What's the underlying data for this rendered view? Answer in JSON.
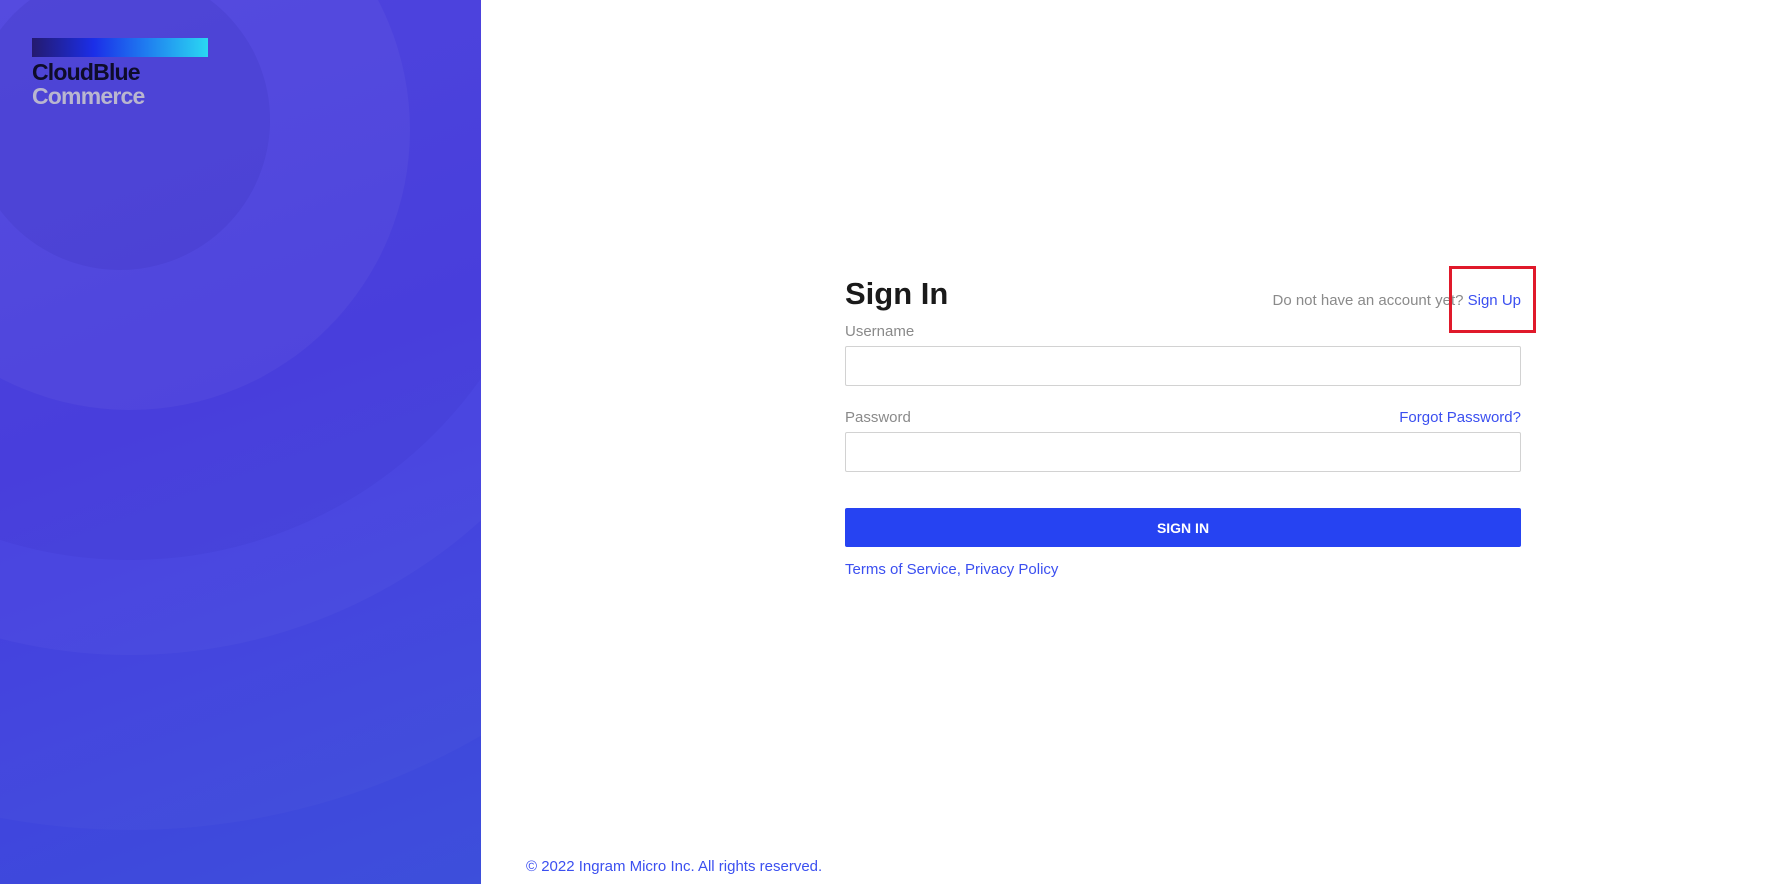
{
  "brand": {
    "logo_line1": "CloudBlue",
    "logo_line2": "Commerce"
  },
  "form": {
    "title": "Sign In",
    "signup_prompt": "Do not have an account yet?",
    "signup_link": "Sign Up",
    "username_label": "Username",
    "username_value": "",
    "password_label": "Password",
    "password_value": "",
    "forgot_password": "Forgot Password?",
    "submit_label": "SIGN IN",
    "terms_link": "Terms of Service",
    "separator": ",",
    "privacy_link": "Privacy Policy"
  },
  "footer": {
    "copyright": "© 2022 Ingram Micro Inc. All rights reserved."
  },
  "colors": {
    "accent": "#2643f2",
    "link": "#3b4ff0",
    "highlight": "#e0192a"
  }
}
